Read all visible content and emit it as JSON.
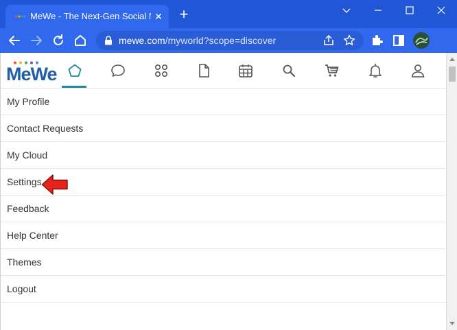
{
  "browser": {
    "tab_title": "MeWe - The Next-Gen Social Net",
    "tab_close": "✕",
    "new_tab": "+",
    "url_host": "mewe.com",
    "url_path": "/myworld?scope=discover",
    "accent": "#2156d6"
  },
  "app": {
    "logo": "MeWe",
    "nav": [
      "home-icon",
      "chat-icon",
      "groups-icon",
      "pages-icon",
      "calendar-icon",
      "search-icon",
      "store-icon",
      "notifications-icon",
      "profile-icon"
    ],
    "active_color": "#1e8aa0"
  },
  "menu": {
    "items": [
      "My Profile",
      "Contact Requests",
      "My Cloud",
      "Settings",
      "Feedback",
      "Help Center",
      "Themes",
      "Logout"
    ]
  },
  "annotation": {
    "arrow_color": "#e8231c"
  }
}
